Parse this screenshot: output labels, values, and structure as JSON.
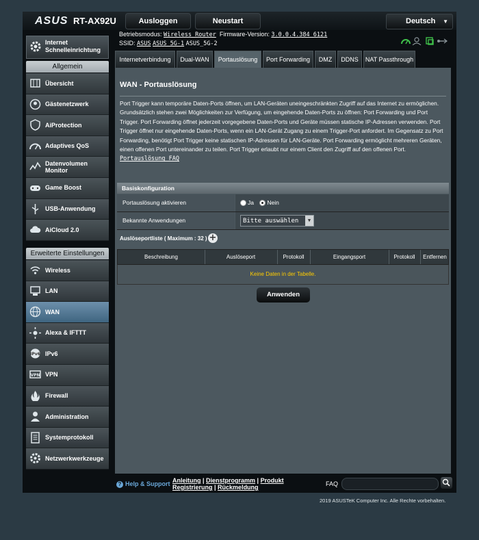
{
  "header": {
    "logo": "ASUS",
    "model": "RT-AX92U",
    "logout_label": "Ausloggen",
    "restart_label": "Neustart",
    "language": "Deutsch"
  },
  "info": {
    "mode_label": "Betriebsmodus:",
    "mode_value": "Wireless Router",
    "firmware_label": "Firmware-Version:",
    "firmware_value": "3.0.0.4.384_6121",
    "ssid_label": "SSID:",
    "ssids": [
      "ASUS",
      "ASUS_5G-1",
      "ASUS_5G-2"
    ]
  },
  "sidebar": {
    "qis_label": "Internet Schnelleinrichtung",
    "general_header": "Allgemein",
    "general_items": [
      {
        "label": "Übersicht",
        "icon": "map-icon"
      },
      {
        "label": "Gästenetzwerk",
        "icon": "guest-network-icon"
      },
      {
        "label": "AiProtection",
        "icon": "shield-icon"
      },
      {
        "label": "Adaptives QoS",
        "icon": "qos-gauge-icon"
      },
      {
        "label": "Datenvolumen Monitor",
        "icon": "traffic-monitor-icon"
      },
      {
        "label": "Game Boost",
        "icon": "gamepad-icon"
      },
      {
        "label": "USB-Anwendung",
        "icon": "usb-icon"
      },
      {
        "label": "AiCloud 2.0",
        "icon": "cloud-icon"
      }
    ],
    "advanced_header": "Erweiterte Einstellungen",
    "advanced_items": [
      {
        "label": "Wireless",
        "icon": "wireless-icon"
      },
      {
        "label": "LAN",
        "icon": "lan-icon"
      },
      {
        "label": "WAN",
        "icon": "globe-icon"
      },
      {
        "label": "Alexa & IFTTT",
        "icon": "alexa-icon"
      },
      {
        "label": "IPv6",
        "icon": "ipv6-icon"
      },
      {
        "label": "VPN",
        "icon": "vpn-icon"
      },
      {
        "label": "Firewall",
        "icon": "firewall-icon"
      },
      {
        "label": "Administration",
        "icon": "admin-icon"
      },
      {
        "label": "Systemprotokoll",
        "icon": "log-icon"
      },
      {
        "label": "Netzwerkwerkzeuge",
        "icon": "tools-icon"
      }
    ]
  },
  "tabs": [
    "Internetverbindung",
    "Dual-WAN",
    "Portauslösung",
    "Port Forwarding",
    "DMZ",
    "DDNS",
    "NAT Passthrough"
  ],
  "page": {
    "title": "WAN - Portauslösung",
    "description": "Port Trigger kann temporäre Daten-Ports öffnen, um LAN-Geräten uneingeschränkten Zugriff auf das Internet zu ermöglichen. Grundsätzlich stehen zwei Möglichkeiten zur Verfügung, um eingehende Daten-Ports zu öffnen: Port Forwarding und Port Trigger. Port Forwarding öffnet jederzeit vorgegebene Daten-Ports und Geräte müssen statische IP-Adressen verwenden. Port Trigger öffnet nur eingehende Daten-Ports, wenn ein LAN-Gerät Zugang zu einem Trigger-Port anfordert. Im Gegensatz zu Port Forwarding, benötigt Port Trigger keine statischen IP-Adressen für LAN-Geräte. Port Forwarding ermöglicht mehreren Geräten, einen offenen Port untereinander zu teilen. Port Trigger erlaubt nur einem Client den Zugriff auf den offenen Port.",
    "faq_link": "Portauslösung FAQ",
    "basic_header": "Basiskonfiguration",
    "enable_label": "Portauslösung aktivieren",
    "yes_label": "Ja",
    "no_label": "Nein",
    "known_apps_label": "Bekannte Anwendungen",
    "known_apps_value": "Bitte auswählen",
    "list_label": "Auslöseportliste ( Maximum : 32 )",
    "table_headers": [
      "Beschreibung",
      "Auslöseport",
      "Protokoll",
      "Eingangsport",
      "Protokoll",
      "Entfernen"
    ],
    "empty_text": "Keine Daten in der Tabelle.",
    "apply_label": "Anwenden"
  },
  "footer": {
    "help_label": "Help & Support",
    "links_line1": [
      "Anleitung",
      "Dienstprogramm",
      "Produkt"
    ],
    "links_line2": [
      "Registrierung",
      "Rückmeldung"
    ],
    "faq_label": "FAQ",
    "copyright": "2019 ASUSTeK Computer Inc. Alle Rechte vorbehalten."
  }
}
